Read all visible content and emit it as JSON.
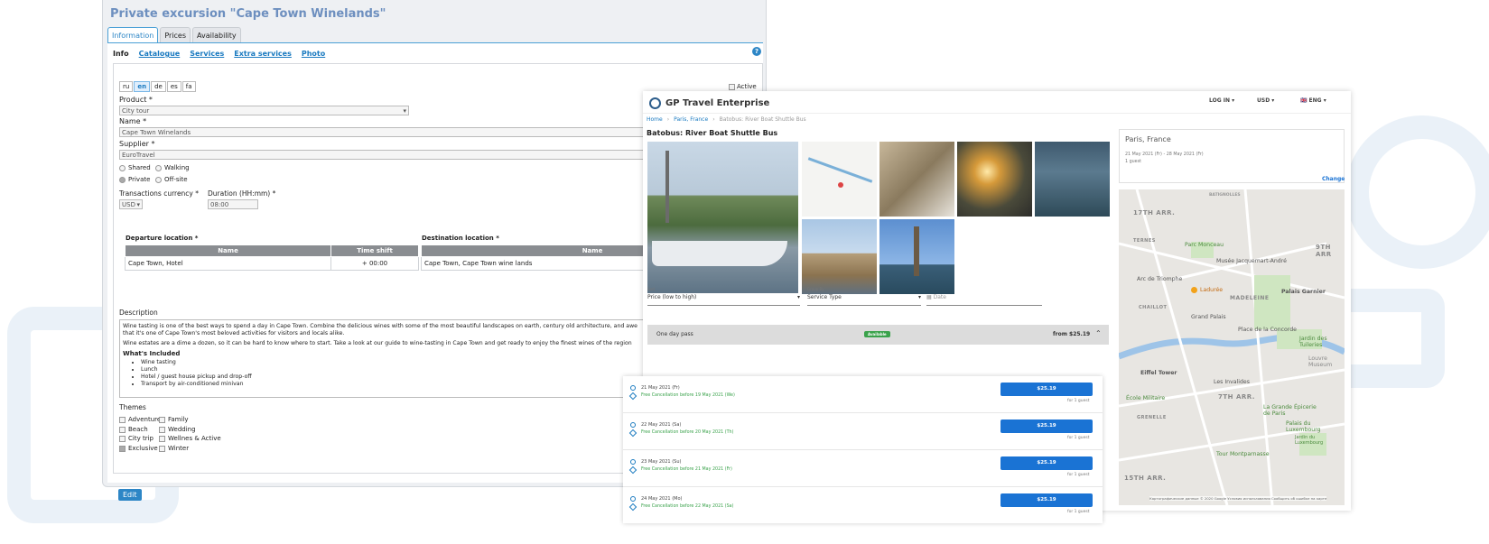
{
  "admin": {
    "title": "Private excursion \"Cape Town Winelands\"",
    "tabs": [
      "Information",
      "Prices",
      "Availability"
    ],
    "subnav_current": "Info",
    "subnav": [
      "Catalogue",
      "Services",
      "Extra services",
      "Photo"
    ],
    "languages": [
      "ru",
      "en",
      "de",
      "es",
      "fa"
    ],
    "active_language": "en",
    "active_label": "Active",
    "product_label": "Product *",
    "product_value": "City tour",
    "name_label": "Name *",
    "name_value": "Cape Town Winelands",
    "supplier_label": "Supplier *",
    "supplier_value": "EuroTravel",
    "type_options": [
      "Shared",
      "Walking",
      "Private",
      "Off-site"
    ],
    "currency_label": "Transactions currency *",
    "currency_value": "USD",
    "duration_label": "Duration (HH:mm) *",
    "duration_value": "08:00",
    "departure_title": "Departure location *",
    "destination_title": "Destination location *",
    "col_name": "Name",
    "col_time_shift": "Time shift",
    "departure_row": {
      "name": "Cape Town, Hotel",
      "shift": "+ 00:00"
    },
    "destination_row": {
      "name": "Cape Town, Cape Town wine lands"
    },
    "description_label": "Description",
    "description_p1": "Wine tasting is one of the best ways to spend a day in Cape Town. Combine the delicious wines with some of the most beautiful landscapes on earth, century old architecture, and awe",
    "description_p1b": "that it's one of Cape Town's most beloved activities for visitors and locals alike.",
    "description_p2": "Wine estates are a dime a dozen, so it can be hard to know where to start. Take a look at our guide to wine-tasting in Cape Town and get ready to enjoy the finest wines of the region",
    "included_title": "What's Included",
    "included": [
      "Wine tasting",
      "Lunch",
      "Hotel / guest house pickup and drop-off",
      "Transport by air-conditioned minivan"
    ],
    "themes_label": "Themes",
    "themes_col1": [
      "Adventure",
      "Beach",
      "City trip",
      "Exclusive"
    ],
    "themes_col2": [
      "Family",
      "Wedding",
      "Wellnes & Active",
      "Winter"
    ],
    "edit_label": "Edit"
  },
  "site": {
    "brand": "GP Travel Enterprise",
    "login": "LOG IN ▾",
    "currency": "USD ▾",
    "language": "🇬🇧 ENG ▾",
    "breadcrumb": [
      "Home",
      "Paris, France",
      "Batobus: River Boat Shuttle Bus"
    ],
    "title": "Batobus: River Boat Shuttle Bus",
    "sort_caption": "Sort",
    "sort_value": "Price (low to high)",
    "group_caption": "Group By",
    "group_value": "Service Type",
    "date_placeholder": "Date",
    "pass_name": "One day pass",
    "pass_status": "Available",
    "pass_price": "from $25.19",
    "search_city": "Paris, France",
    "search_dates": "21 May 2021 (Fr) - 28 May 2021 (Fr)",
    "search_guests": "1 guest",
    "change_label": "Change",
    "map_labels": [
      "17TH ARR.",
      "BATIGNOLLES",
      "TERNES",
      "Parc Monceau",
      "9TH ARR",
      "Musée Jacquemart-André",
      "Arc de Triomphe",
      "Ladurée",
      "Palais Garnier",
      "MADELEINE",
      "CHAILLOT",
      "Grand Palais",
      "Place de la Concorde",
      "Jardin des Tuileries",
      "Louvre Museum",
      "Eiffel Tower",
      "Les Invalides",
      "7TH ARR.",
      "École Militaire",
      "La Grande Épicerie de Paris",
      "Palais du Luxembourg",
      "GRENELLE",
      "Tour Montparnasse",
      "Jardin du Luxembourg",
      "15TH ARR.",
      "Картографические данные © 2020 Google  Условия использования  Сообщить об ошибке на карте"
    ]
  },
  "dates": [
    {
      "date": "21 May 2021 (Fr)",
      "cancel": "Free Cancellation before 19 May 2021 (We)",
      "price": "$25.19",
      "guests": "for 1 guest"
    },
    {
      "date": "22 May 2021 (Sa)",
      "cancel": "Free Cancellation before 20 May 2021 (Th)",
      "price": "$25.19",
      "guests": "for 1 guest"
    },
    {
      "date": "23 May 2021 (Su)",
      "cancel": "Free Cancellation before 21 May 2021 (Fr)",
      "price": "$25.19",
      "guests": "for 1 guest"
    },
    {
      "date": "24 May 2021 (Mo)",
      "cancel": "Free Cancellation before 22 May 2021 (Sa)",
      "price": "$25.19",
      "guests": "for 1 guest"
    }
  ],
  "colors": {
    "accent": "#1a73d4",
    "admin_title": "#6d8fbf",
    "available": "#3aa24b"
  }
}
